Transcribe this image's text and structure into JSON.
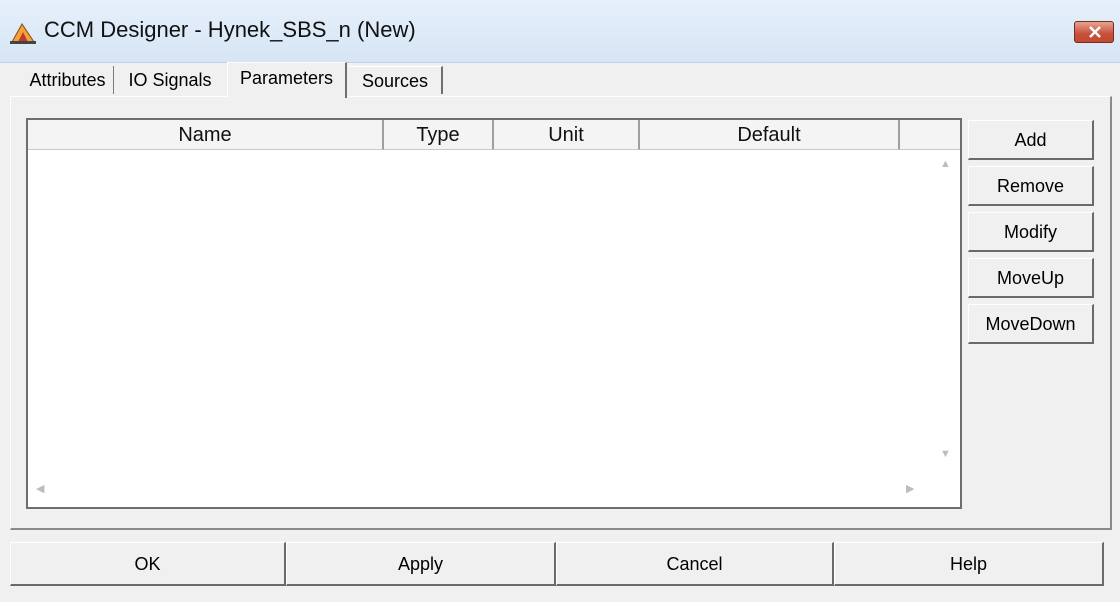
{
  "window": {
    "title": "CCM Designer - Hynek_SBS_n (New)"
  },
  "tabs": [
    {
      "label": "Attributes",
      "active": false
    },
    {
      "label": "IO Signals",
      "active": false
    },
    {
      "label": "Parameters",
      "active": true
    },
    {
      "label": "Sources",
      "active": false
    }
  ],
  "table": {
    "columns": [
      "Name",
      "Type",
      "Unit",
      "Default",
      ""
    ],
    "rows": []
  },
  "side_buttons": {
    "add": "Add",
    "remove": "Remove",
    "modify": "Modify",
    "moveup": "MoveUp",
    "movedown": "MoveDown"
  },
  "bottom_buttons": {
    "ok": "OK",
    "apply": "Apply",
    "cancel": "Cancel",
    "help": "Help"
  },
  "icons": {
    "app": "ccm-designer-app-icon",
    "close": "close-icon"
  },
  "colors": {
    "titlebar": "#d6e5f5",
    "close_button": "#c7503a",
    "dialog_bg": "#f0f0f0"
  }
}
